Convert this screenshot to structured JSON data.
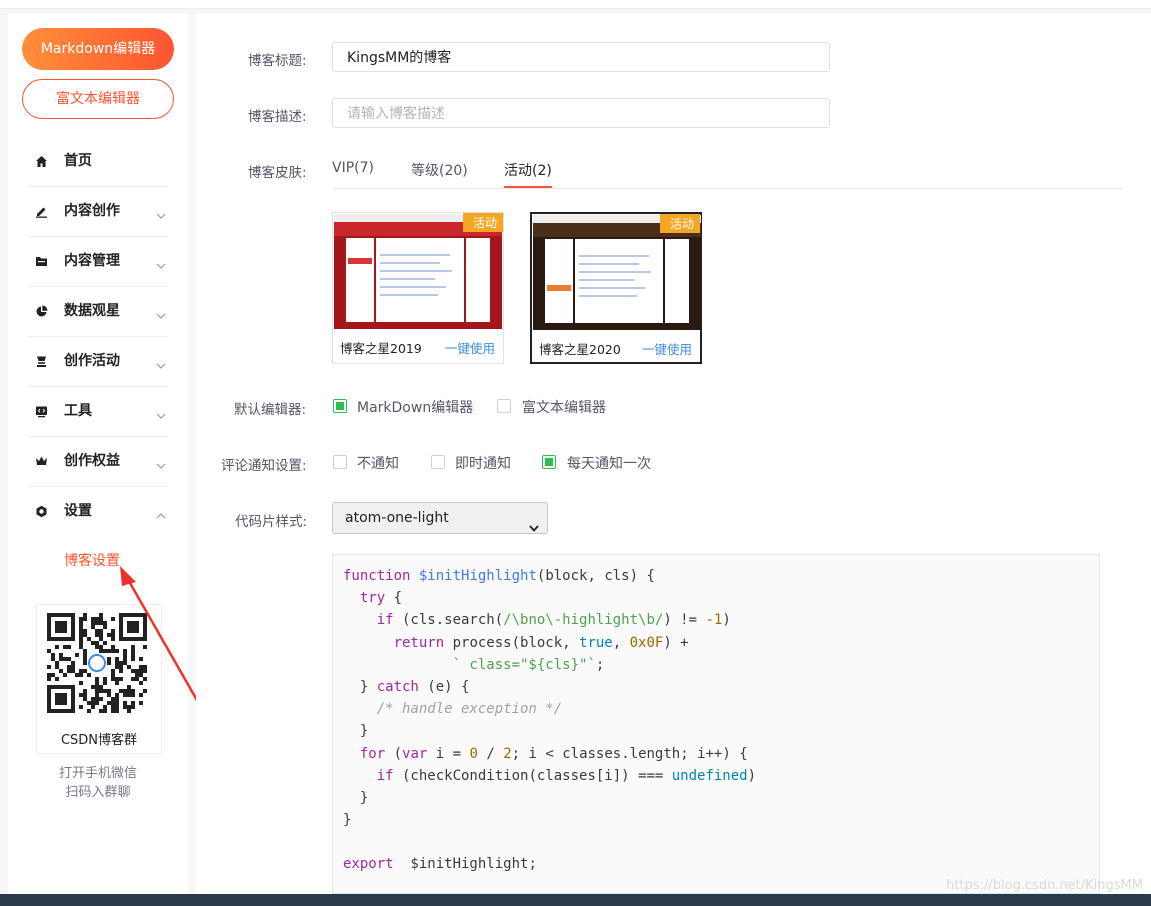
{
  "sidebar": {
    "markdown_btn": "Markdown编辑器",
    "richtext_btn": "富文本编辑器",
    "nav": [
      {
        "label": "首页",
        "icon": "home-icon"
      },
      {
        "label": "内容创作",
        "icon": "pen-icon"
      },
      {
        "label": "内容管理",
        "icon": "folder-icon"
      },
      {
        "label": "数据观星",
        "icon": "pie-chart-icon"
      },
      {
        "label": "创作活动",
        "icon": "trophy-icon"
      },
      {
        "label": "工具",
        "icon": "code-tool-icon"
      },
      {
        "label": "创作权益",
        "icon": "crown-icon"
      },
      {
        "label": "设置",
        "icon": "settings-icon"
      }
    ],
    "sub_item": "博客设置",
    "qr_caption": "CSDN博客群",
    "qr_note": [
      "打开手机微信",
      "扫码入群聊"
    ]
  },
  "form": {
    "title_label": "博客标题:",
    "title_value": "KingsMM的博客",
    "desc_label": "博客描述:",
    "desc_placeholder": "请输入博客描述",
    "skin_label": "博客皮肤:",
    "skin_tabs": [
      "VIP(7)",
      "等级(20)",
      "活动(2)"
    ],
    "skins": [
      {
        "name": "博客之星2019",
        "tag": "活动",
        "action": "一键使用"
      },
      {
        "name": "博客之星2020",
        "tag": "活动",
        "action": "一键使用"
      }
    ],
    "editor_label": "默认编辑器:",
    "editor_options": [
      "MarkDown编辑器",
      "富文本编辑器"
    ],
    "comment_label": "评论通知设置:",
    "comment_options": [
      "不通知",
      "即时通知",
      "每天通知一次"
    ],
    "code_style_label": "代码片样式:",
    "code_style_value": "atom-one-light"
  },
  "watermark": "https://blog.csdn.net/KingsMM",
  "colors": {
    "brand": "#fc5531",
    "check": "#2dbe4f",
    "link": "#3b8ce2",
    "tag": "#f5a623"
  }
}
